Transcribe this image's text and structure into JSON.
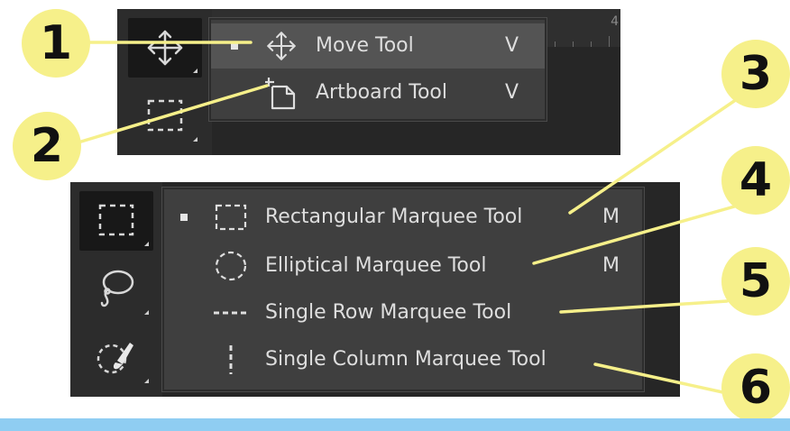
{
  "colors": {
    "panel_bg": "#262626",
    "menu_bg": "#3f3f3f",
    "menu_highlight": "#545454",
    "menu_text": "#dedede",
    "callout_fill": "#f6f08a",
    "bottom_band": "#8fcdf2"
  },
  "ruler": {
    "number": "4"
  },
  "move_menu": {
    "items": [
      {
        "label": "Move Tool",
        "shortcut": "V",
        "icon": "move-icon",
        "selected": true,
        "highlighted": true
      },
      {
        "label": "Artboard Tool",
        "shortcut": "V",
        "icon": "artboard-icon",
        "selected": false,
        "highlighted": false
      }
    ]
  },
  "marquee_menu": {
    "items": [
      {
        "label": "Rectangular Marquee Tool",
        "shortcut": "M",
        "icon": "rectangular-marquee-icon",
        "selected": true
      },
      {
        "label": "Elliptical Marquee Tool",
        "shortcut": "M",
        "icon": "elliptical-marquee-icon",
        "selected": false
      },
      {
        "label": "Single Row Marquee Tool",
        "shortcut": "",
        "icon": "single-row-marquee-icon",
        "selected": false
      },
      {
        "label": "Single Column Marquee Tool",
        "shortcut": "",
        "icon": "single-column-marquee-icon",
        "selected": false
      }
    ]
  },
  "toolbar_icons": [
    "move-icon",
    "rectangular-marquee-icon",
    "lasso-icon",
    "quick-selection-icon"
  ],
  "callouts": [
    "1",
    "2",
    "3",
    "4",
    "5",
    "6"
  ]
}
